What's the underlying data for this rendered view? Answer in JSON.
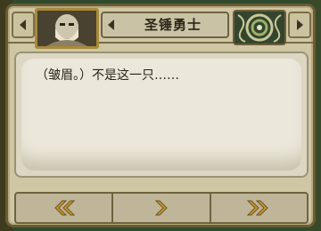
{
  "header": {
    "speaker_name": "圣锤勇士"
  },
  "dialog": {
    "text": "（皱眉。）不是这一只……"
  },
  "icons": {
    "prev_speaker": "triangle-left-icon",
    "next_speaker": "triangle-right-icon",
    "portrait": "bald-warrior-portrait",
    "monster": "coiled-monster-portrait",
    "back": "double-chevron-left-icon",
    "forward": "chevron-right-icon",
    "fast_forward": "double-chevron-right-icon"
  },
  "colors": {
    "frame": "#cfc6a4",
    "border": "#6a5b35",
    "gold": "#c99a2e",
    "text": "#2a2416"
  }
}
